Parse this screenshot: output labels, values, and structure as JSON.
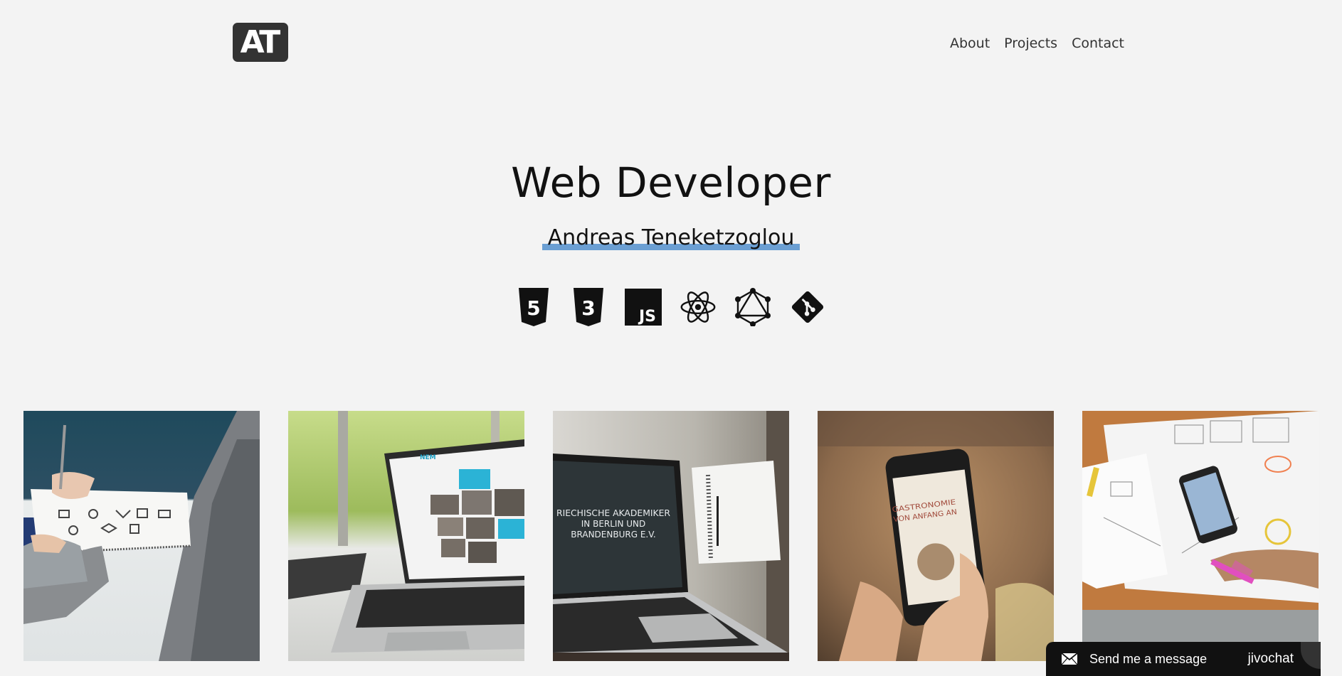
{
  "logo": {
    "text": "AT"
  },
  "nav": [
    {
      "label": "About"
    },
    {
      "label": "Projects"
    },
    {
      "label": "Contact"
    }
  ],
  "hero": {
    "title": "Web Developer",
    "subtitle": "Andreas Teneketzoglou",
    "subtitle_highlight_color": "#6b9fd3"
  },
  "skills": [
    {
      "icon": "html5-icon",
      "label": "5"
    },
    {
      "icon": "css3-icon",
      "label": "3"
    },
    {
      "icon": "javascript-icon",
      "label": "JS"
    },
    {
      "icon": "react-icon"
    },
    {
      "icon": "graphql-icon"
    },
    {
      "icon": "git-icon"
    }
  ],
  "projects": [
    {
      "image": "sketching-logos-photo"
    },
    {
      "image": "laptop-nem-photo",
      "screen_text": "NEM"
    },
    {
      "image": "laptop-akademiker-photo",
      "screen_text": "RIECHISCHE AKADEMIKER IN BERLIN UND BRANDENBURG E.V."
    },
    {
      "image": "phone-gastronomie-photo",
      "screen_text": "GASTRONOMIE VON ANFANG AN"
    },
    {
      "image": "wireframe-desk-photo"
    }
  ],
  "chat_widget": {
    "label": "Send me a message",
    "brand": "jivochat",
    "icon": "mail-icon"
  }
}
